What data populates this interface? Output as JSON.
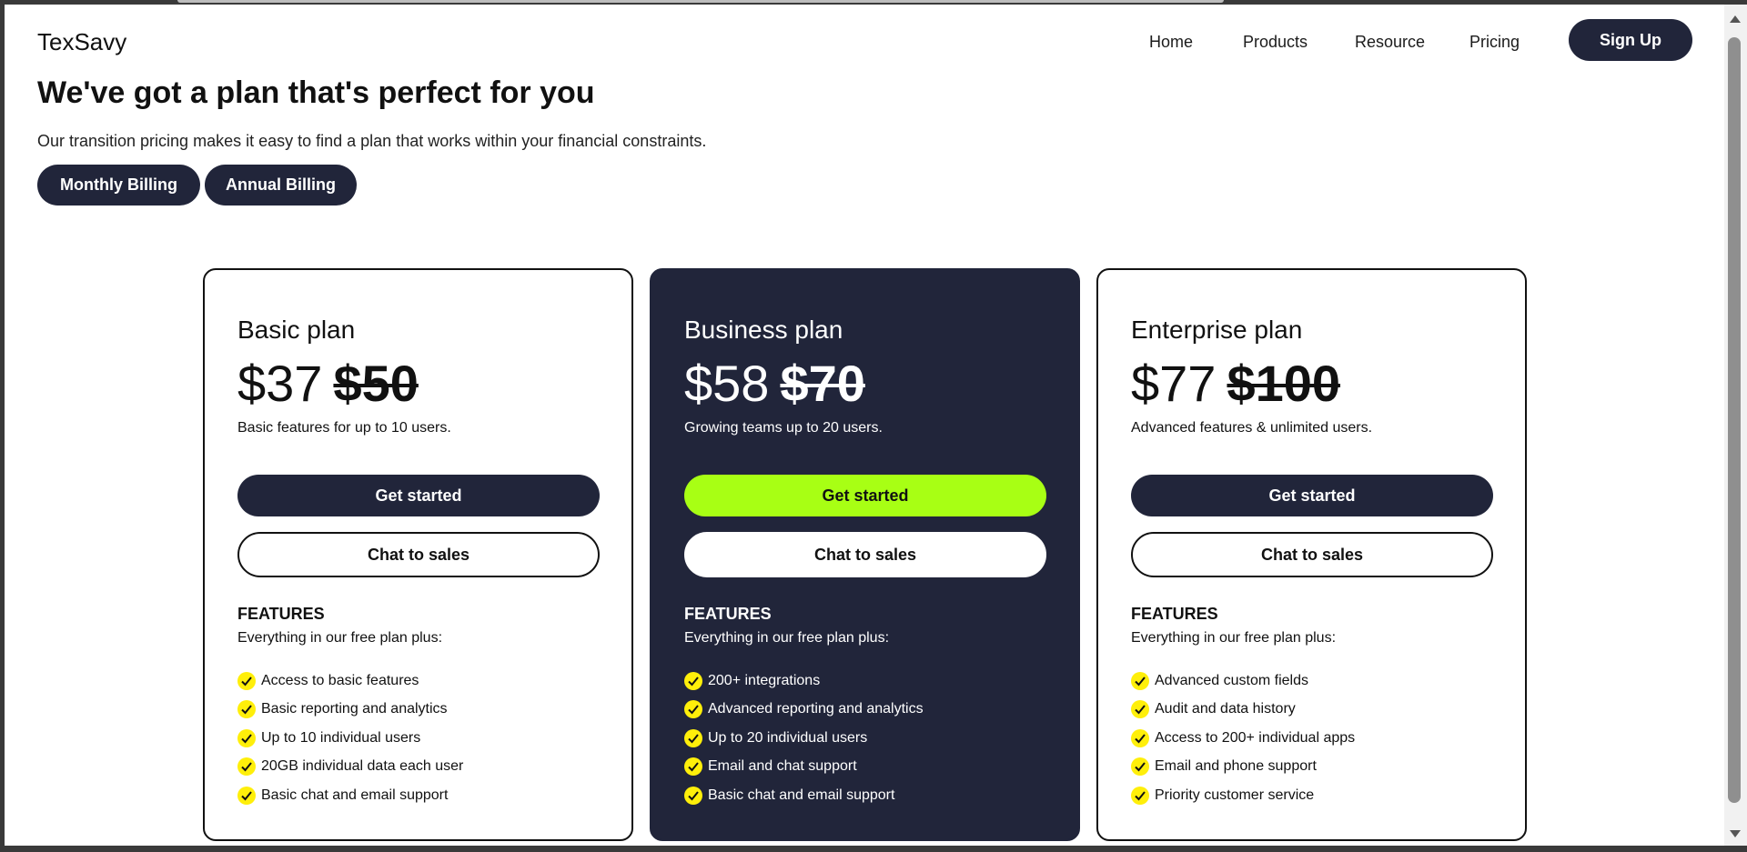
{
  "app": {
    "logo": "TexSavy"
  },
  "nav": {
    "items": [
      {
        "label": "Home"
      },
      {
        "label": "Products"
      },
      {
        "label": "Resource"
      },
      {
        "label": "Pricing"
      }
    ],
    "signup_label": "Sign Up"
  },
  "hero": {
    "headline": "We've got a plan that's perfect for you",
    "subline": "Our transition pricing makes it easy to find a plan that works within your financial constraints."
  },
  "billing": {
    "monthly": "Monthly Billing",
    "annual": "Annual Billing"
  },
  "plans": [
    {
      "name": "Basic plan",
      "price": "$37",
      "old_price": "$50",
      "description": "Basic features for up to 10 users.",
      "cta": "Get started",
      "chat": "Chat to sales",
      "features_title": "FEATURES",
      "features_sub": "Everything in our free plan plus:",
      "features": [
        "Access to basic features",
        "Basic reporting and analytics",
        "Up to 10 individual users",
        "20GB individual data each user",
        "Basic chat and email support"
      ]
    },
    {
      "name": "Business plan",
      "price": "$58",
      "old_price": "$70",
      "description": "Growing teams up to 20 users.",
      "cta": "Get started",
      "chat": "Chat to sales",
      "features_title": "FEATURES",
      "features_sub": "Everything in our free plan plus:",
      "features": [
        "200+ integrations",
        "Advanced reporting and analytics",
        "Up to 20 individual users",
        "Email and chat support",
        "Basic chat and email support"
      ]
    },
    {
      "name": "Enterprise plan",
      "price": "$77",
      "old_price": "$100",
      "description": "Advanced features & unlimited users.",
      "cta": "Get started",
      "chat": "Chat to sales",
      "features_title": "FEATURES",
      "features_sub": "Everything in our free plan plus:",
      "features": [
        "Advanced custom fields",
        "Audit and data history",
        "Access to 200+ individual apps",
        "Email and phone support",
        "Priority customer service"
      ]
    }
  ],
  "colors": {
    "navy": "#21253a",
    "accent_green": "#a8ff14",
    "check_yellow": "#ffef0a"
  },
  "icons": {
    "feature_check": "check-circle-icon"
  }
}
